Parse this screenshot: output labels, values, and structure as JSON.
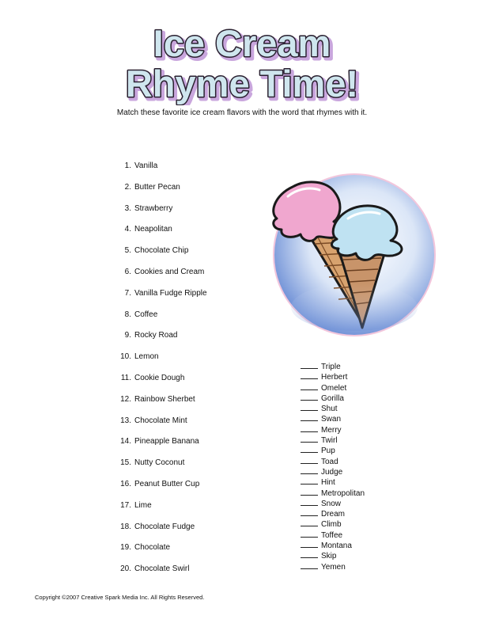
{
  "worksheet": {
    "title_line1": "Ice Cream",
    "title_line2": "Rhyme Time!",
    "instructions": "Match these favorite ice cream flavors with the word that rhymes with it."
  },
  "flavors": [
    {
      "number": "1.",
      "name": "Vanilla"
    },
    {
      "number": "2.",
      "name": "Butter Pecan"
    },
    {
      "number": "3.",
      "name": "Strawberry"
    },
    {
      "number": "4.",
      "name": "Neapolitan"
    },
    {
      "number": "5.",
      "name": "Chocolate Chip"
    },
    {
      "number": "6.",
      "name": "Cookies and Cream"
    },
    {
      "number": "7.",
      "name": "Vanilla Fudge Ripple"
    },
    {
      "number": "8.",
      "name": "Coffee"
    },
    {
      "number": "9.",
      "name": "Rocky Road"
    },
    {
      "number": "10.",
      "name": "Lemon"
    },
    {
      "number": "11.",
      "name": "Cookie Dough"
    },
    {
      "number": "12.",
      "name": "Rainbow Sherbet"
    },
    {
      "number": "13.",
      "name": "Chocolate Mint"
    },
    {
      "number": "14.",
      "name": "Pineapple Banana"
    },
    {
      "number": "15.",
      "name": "Nutty Coconut"
    },
    {
      "number": "16.",
      "name": "Peanut Butter Cup"
    },
    {
      "number": "17.",
      "name": "Lime"
    },
    {
      "number": "18.",
      "name": "Chocolate Fudge"
    },
    {
      "number": "19.",
      "name": "Chocolate"
    },
    {
      "number": "20.",
      "name": "Chocolate Swirl"
    }
  ],
  "rhymes": [
    "Triple",
    "Herbert",
    "Omelet",
    "Gorilla",
    "Shut",
    "Swan",
    "Merry",
    "Twirl",
    "Pup",
    "Toad",
    "Judge",
    "Hint",
    "Metropolitan",
    "Snow",
    "Dream",
    "Climb",
    "Toffee",
    "Montana",
    "Skip",
    "Yemen"
  ],
  "footer": {
    "copyright": "Copyright ©2007  Creative Spark Media Inc.  All Rights Reserved."
  },
  "colors": {
    "title_fill": "#cfe6ee",
    "title_outline": "#2a2030",
    "title_shadow": "#c9a6dd",
    "scoop_pink": "#f0a7cf",
    "scoop_blue": "#bfe2f2",
    "cone": "#d7a26e",
    "halo": "#6d8fd6"
  }
}
